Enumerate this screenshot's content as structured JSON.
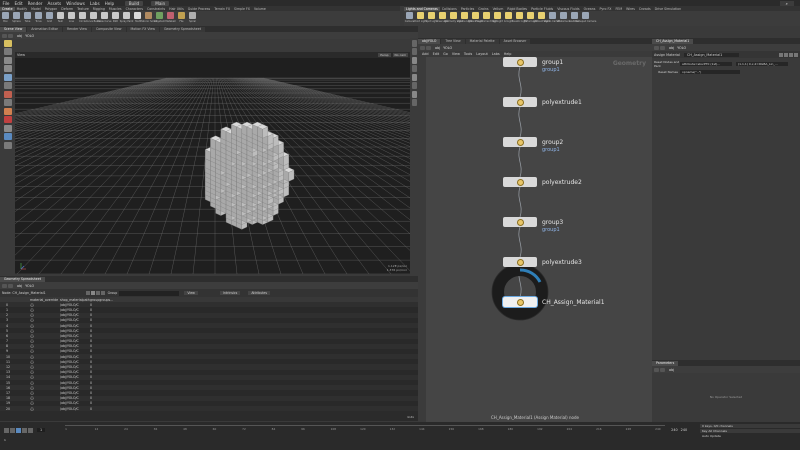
{
  "menu": {
    "items": [
      "File",
      "Edit",
      "Render",
      "Assets",
      "Windows",
      "Labs",
      "Help"
    ],
    "desktop": "Build",
    "main": "Main"
  },
  "shelf_left": {
    "tabs": [
      "Create",
      "Modify",
      "Model",
      "Polygon",
      "Deform",
      "Texture",
      "Rigging",
      "Muscles",
      "Characters",
      "Constraints",
      "Hair Utils",
      "Guide Process",
      "Terrain FX",
      "Simple FX",
      "Volume"
    ],
    "tools": [
      {
        "label": "Box",
        "color": "#9aa6b6"
      },
      {
        "label": "Sphere",
        "color": "#9aa6b6"
      },
      {
        "label": "Tube",
        "color": "#9aa6b6"
      },
      {
        "label": "Torus",
        "color": "#9aa6b6"
      },
      {
        "label": "Grid",
        "color": "#9aa6b6"
      },
      {
        "label": "Null",
        "color": "#c8c8c8"
      },
      {
        "label": "Line",
        "color": "#c8c8c8"
      },
      {
        "label": "Circle",
        "color": "#c8c8c8"
      },
      {
        "label": "Curve Bezier",
        "color": "#c8c8c8"
      },
      {
        "label": "Draw Curve",
        "color": "#c8c8c8"
      },
      {
        "label": "Path",
        "color": "#c8c8c8"
      },
      {
        "label": "Spray Paint",
        "color": "#c8c8c8"
      },
      {
        "label": "Text",
        "color": "#dcdcdc"
      },
      {
        "label": "Platonic Solids",
        "color": "#b08a60"
      },
      {
        "label": "L-System",
        "color": "#70a060"
      },
      {
        "label": "Metaball",
        "color": "#c06070"
      },
      {
        "label": "File",
        "color": "#c0a050"
      },
      {
        "label": "Spiral",
        "color": "#b0b0b0"
      }
    ]
  },
  "shelf_right": {
    "tabs": [
      "Lights and Cameras",
      "Collisions",
      "Particles",
      "Grains",
      "Vellum",
      "Rigid Bodies",
      "Particle Fluids",
      "Viscous Fluids",
      "Oceans",
      "Pyro FX",
      "FEM",
      "Wires",
      "Crowds",
      "Drive Simulation"
    ],
    "tools": [
      {
        "label": "Camera",
        "color": "#9aa6b6"
      },
      {
        "label": "Point Light",
        "color": "#e8d070"
      },
      {
        "label": "Spot Light",
        "color": "#e8d070"
      },
      {
        "label": "Area Light",
        "color": "#e8d070"
      },
      {
        "label": "Geometry Light",
        "color": "#e8d070"
      },
      {
        "label": "Volume Light",
        "color": "#e8d070"
      },
      {
        "label": "Distant Light",
        "color": "#e8d070"
      },
      {
        "label": "Environment Light",
        "color": "#e8d070"
      },
      {
        "label": "Sky Light",
        "color": "#e8d070"
      },
      {
        "label": "GI Light",
        "color": "#e8d070"
      },
      {
        "label": "Caustic Light",
        "color": "#e8d070"
      },
      {
        "label": "Portal Light",
        "color": "#e8d070"
      },
      {
        "label": "Ambient Light",
        "color": "#e8d070"
      },
      {
        "label": "Stereo Camera",
        "color": "#9aa6b6"
      },
      {
        "label": "VR Camera",
        "color": "#9aa6b6"
      },
      {
        "label": "Switcher",
        "color": "#9aa6b6"
      },
      {
        "label": "Gamepad Camera",
        "color": "#9aa6b6"
      }
    ]
  },
  "viewport": {
    "tabs": [
      "Scene View",
      "Animation Editor",
      "Render View",
      "Composite View",
      "Motion FX View",
      "Geometry Spreadsheet"
    ],
    "path": "obj",
    "node": "YOLO",
    "view_label": "View",
    "persp": "Persp",
    "cam": "No cam",
    "readout": [
      "1.12E  px/xor",
      "1.376 px/rnxr"
    ]
  },
  "spreadsheet": {
    "tabs": [
      "Geometry Spreadsheet"
    ],
    "path": "obj",
    "node": "YOLO",
    "node_label": "Node: CH_Assign_Material1",
    "filter": "Group",
    "view": "View",
    "intrinsics": "Intrinsics",
    "attributes": "Attributes",
    "headers": [
      "",
      "material_override",
      "shop_materialpath",
      "groupgroups..."
    ],
    "rows": [
      {
        "i": "0",
        "a": "{}",
        "b": "/obj/YOLO/C",
        "c": "0"
      },
      {
        "i": "1",
        "a": "{}",
        "b": "/obj/YOLO/C",
        "c": "0"
      },
      {
        "i": "2",
        "a": "{}",
        "b": "/obj/YOLO/C",
        "c": "0"
      },
      {
        "i": "3",
        "a": "{}",
        "b": "/obj/YOLO/C",
        "c": "0"
      },
      {
        "i": "4",
        "a": "{}",
        "b": "/obj/YOLO/C",
        "c": "0"
      },
      {
        "i": "5",
        "a": "{}",
        "b": "/obj/YOLO/C",
        "c": "0"
      },
      {
        "i": "6",
        "a": "{}",
        "b": "/obj/YOLO/C",
        "c": "0"
      },
      {
        "i": "7",
        "a": "{}",
        "b": "/obj/YOLO/C",
        "c": "0"
      },
      {
        "i": "8",
        "a": "{}",
        "b": "/obj/YOLO/C",
        "c": "0"
      },
      {
        "i": "9",
        "a": "{}",
        "b": "/obj/YOLO/C",
        "c": "0"
      },
      {
        "i": "10",
        "a": "{}",
        "b": "/obj/YOLO/C",
        "c": "0"
      },
      {
        "i": "11",
        "a": "{}",
        "b": "/obj/YOLO/C",
        "c": "0"
      },
      {
        "i": "12",
        "a": "{}",
        "b": "/obj/YOLO/C",
        "c": "0"
      },
      {
        "i": "13",
        "a": "{}",
        "b": "/obj/YOLO/C",
        "c": "0"
      },
      {
        "i": "14",
        "a": "{}",
        "b": "/obj/YOLO/C",
        "c": "0"
      },
      {
        "i": "15",
        "a": "{}",
        "b": "/obj/YOLO/C",
        "c": "0"
      },
      {
        "i": "16",
        "a": "{}",
        "b": "/obj/YOLO/C",
        "c": "0"
      },
      {
        "i": "17",
        "a": "{}",
        "b": "/obj/YOLO/C",
        "c": "0"
      },
      {
        "i": "18",
        "a": "{}",
        "b": "/obj/YOLO/C",
        "c": "0"
      },
      {
        "i": "19",
        "a": "{}",
        "b": "/obj/YOLO/C",
        "c": "0"
      },
      {
        "i": "20",
        "a": "{}",
        "b": "/obj/YOLO/C",
        "c": "0"
      }
    ],
    "footer": "Indx"
  },
  "network": {
    "tabs": [
      "obj/YOLO",
      "Tree View",
      "Material Palette",
      "Asset Browser"
    ],
    "path": "obj",
    "node": "YOLO",
    "menus": [
      "Add",
      "Edit",
      "Go",
      "View",
      "Tools",
      "Layout",
      "Labs",
      "Help"
    ],
    "context": "Geometry",
    "nodes": [
      {
        "name": "group1",
        "group": "group1"
      },
      {
        "name": "polyextrude1",
        "group": ""
      },
      {
        "name": "group2",
        "group": "group1"
      },
      {
        "name": "polyextrude2",
        "group": ""
      },
      {
        "name": "group3",
        "group": "group1"
      },
      {
        "name": "polyextrude3",
        "group": ""
      },
      {
        "name": "CH_Assign_Material1",
        "group": ""
      }
    ],
    "status": "CH_Assign_Material1 (Assign Material) node"
  },
  "params": {
    "tabs": [
      "CH_Assign_Material1"
    ],
    "path": "obj",
    "node": "YOLO",
    "type": "Assign Material",
    "name": "CH_Assign_Material1",
    "row1_label": "Reset Nodes and Pack",
    "row1_v1": "attribute=sbsrPT0 (1st)...",
    "row1_v2": "(1,1,1) 0,x,2=RGBA_Lin_...",
    "row2_label": "Reset Names",
    "row2_value": "opname(\"..\")",
    "lower_tab": "Parameters",
    "lower_path": "obj",
    "empty": "No Operator Selected"
  },
  "timeline": {
    "frame": "1",
    "start": "1",
    "end": "240",
    "end2": "240",
    "ticks": [
      "1",
      "12",
      "24",
      "36",
      "48",
      "60",
      "72",
      "84",
      "96",
      "108",
      "120",
      "132",
      "144",
      "156",
      "168",
      "180",
      "192",
      "204",
      "216",
      "228",
      "240"
    ],
    "keys_label": "0 keys, 0/0 channels",
    "key_all": "Key All Channels",
    "auto_update": "Auto Update"
  }
}
